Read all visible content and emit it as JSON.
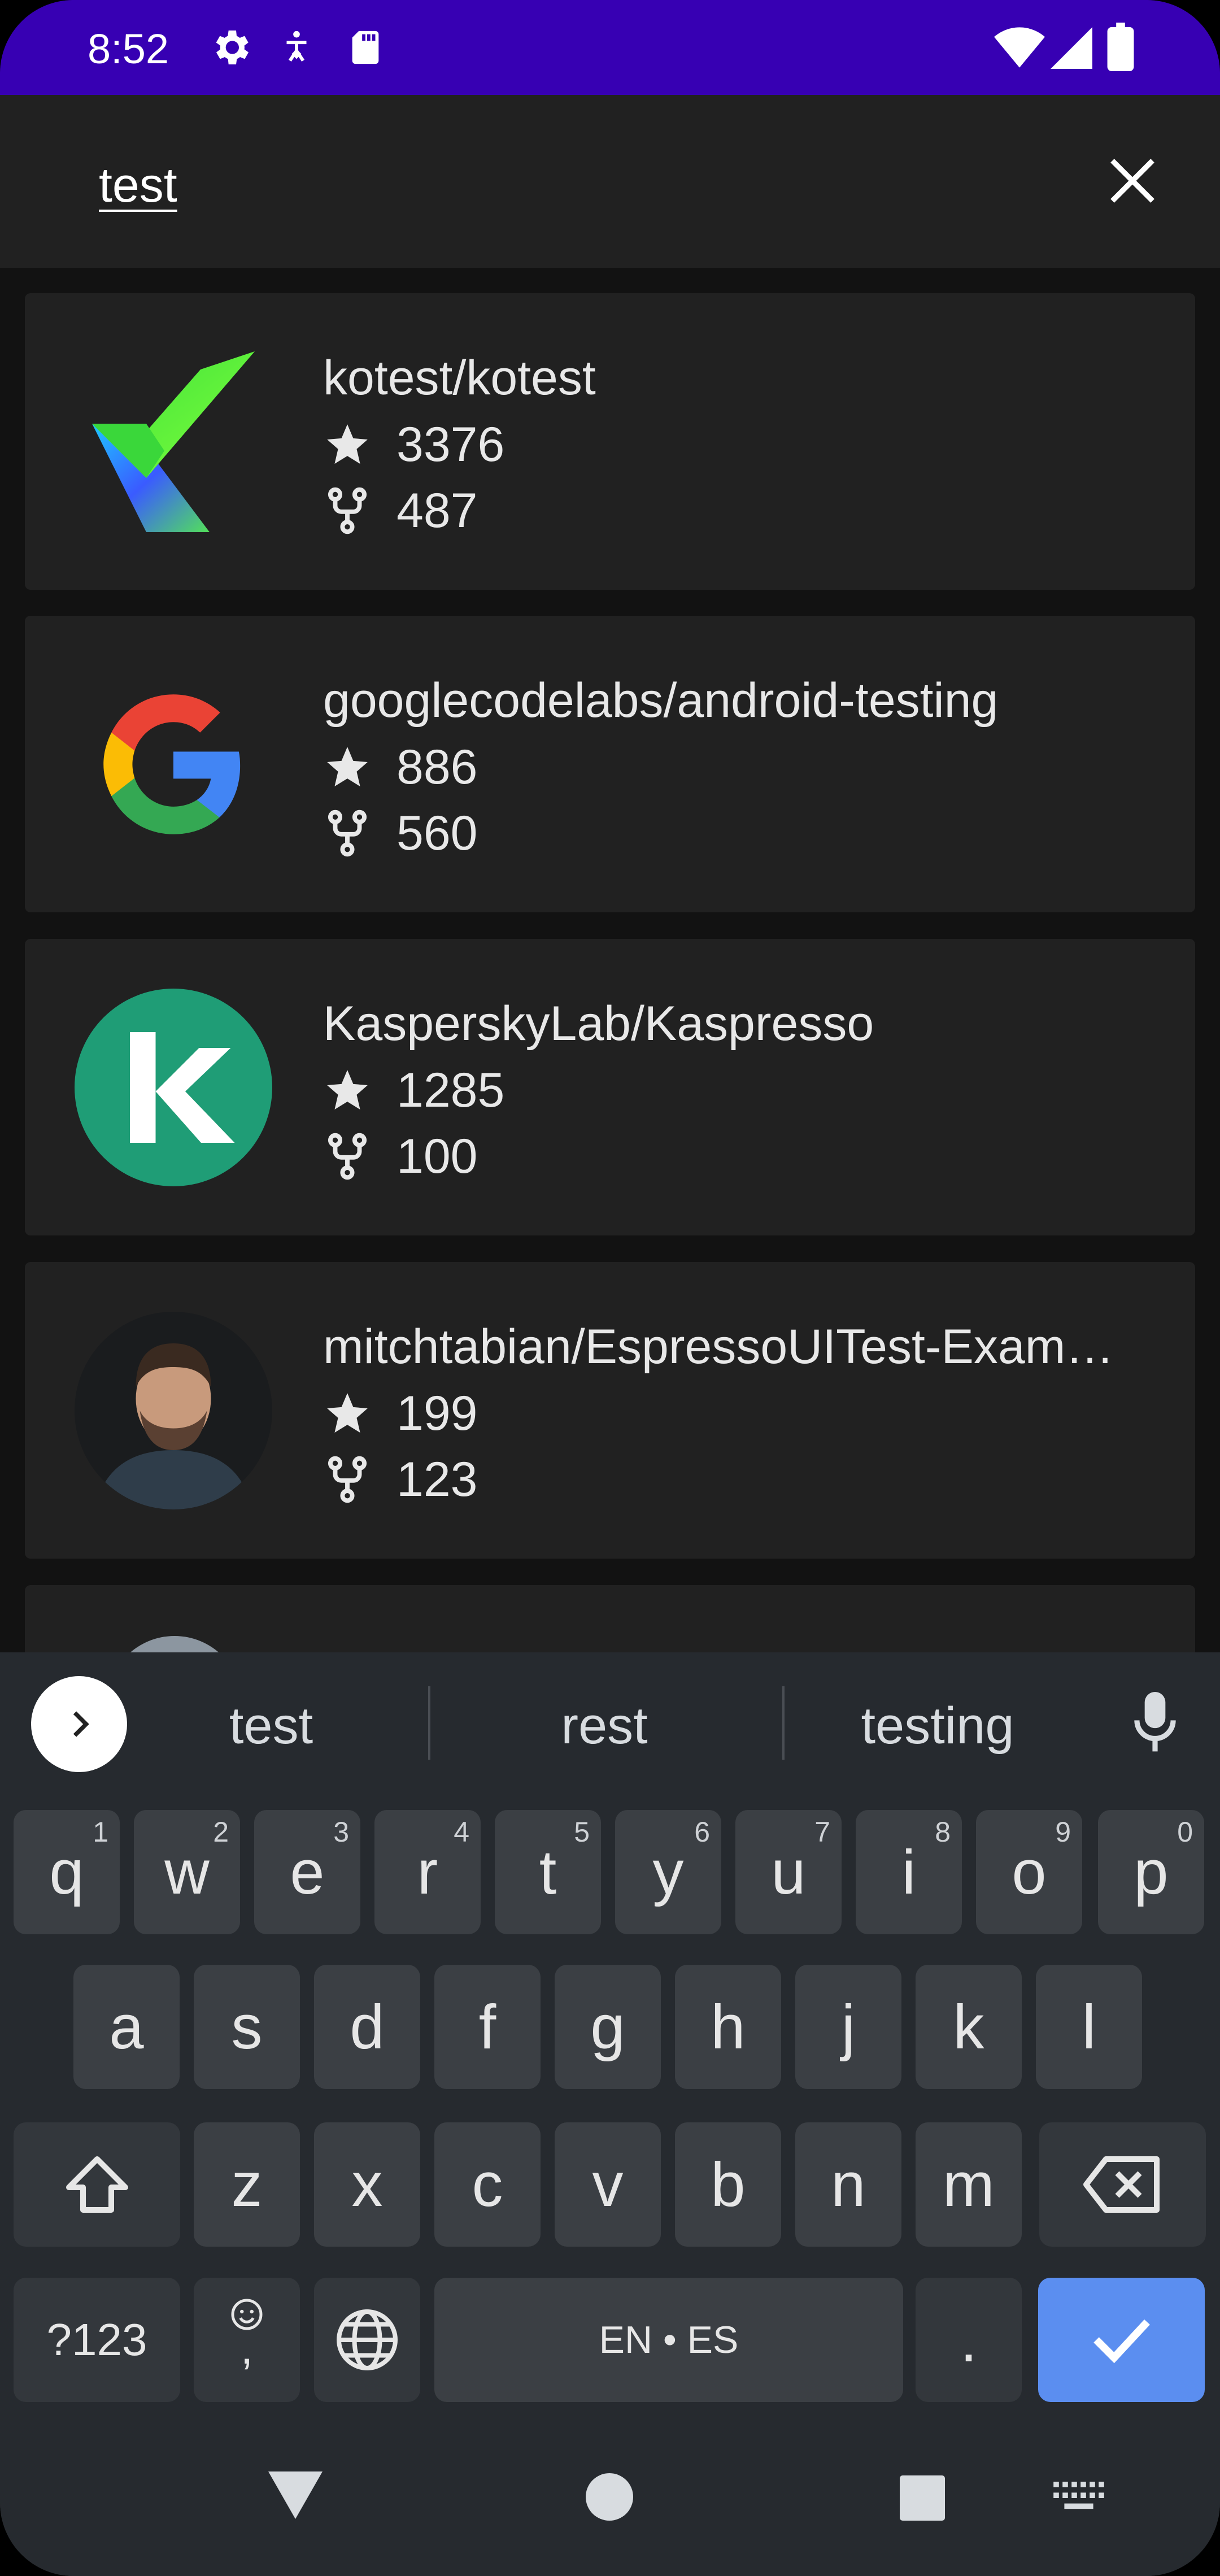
{
  "status_bar": {
    "time": "8:52",
    "left_icons": [
      "settings-icon",
      "accessibility-icon",
      "sd-card-icon"
    ],
    "right_icons": [
      "wifi-icon",
      "signal-icon",
      "battery-icon"
    ]
  },
  "search": {
    "query": "test",
    "clear_icon": "close-icon"
  },
  "results": [
    {
      "name": "kotest/kotest",
      "stars": "3376",
      "forks": "487",
      "avatar": "kotest-logo"
    },
    {
      "name": "googlecodelabs/android-testing",
      "stars": "886",
      "forks": "560",
      "avatar": "google-logo"
    },
    {
      "name": "KasperskyLab/Kaspresso",
      "stars": "1285",
      "forks": "100",
      "avatar": "kaspersky-logo"
    },
    {
      "name": "mitchtabian/EspressoUITest-Exam…",
      "stars": "199",
      "forks": "123",
      "avatar": "user-photo"
    }
  ],
  "keyboard": {
    "suggestions": [
      "test",
      "rest",
      "testing"
    ],
    "row1": [
      "q",
      "w",
      "e",
      "r",
      "t",
      "y",
      "u",
      "i",
      "o",
      "p"
    ],
    "row1_hints": [
      "1",
      "2",
      "3",
      "4",
      "5",
      "6",
      "7",
      "8",
      "9",
      "0"
    ],
    "row2": [
      "a",
      "s",
      "d",
      "f",
      "g",
      "h",
      "j",
      "k",
      "l"
    ],
    "row3": [
      "z",
      "x",
      "c",
      "v",
      "b",
      "n",
      "m"
    ],
    "symbols_label": "?123",
    "comma_label": ",",
    "space_label": "EN • ES",
    "period_label": ".",
    "accent_color": "#5b8ef0"
  },
  "nav": {
    "icons": [
      "back-icon",
      "home-icon",
      "recents-icon",
      "keyboard-icon"
    ]
  }
}
